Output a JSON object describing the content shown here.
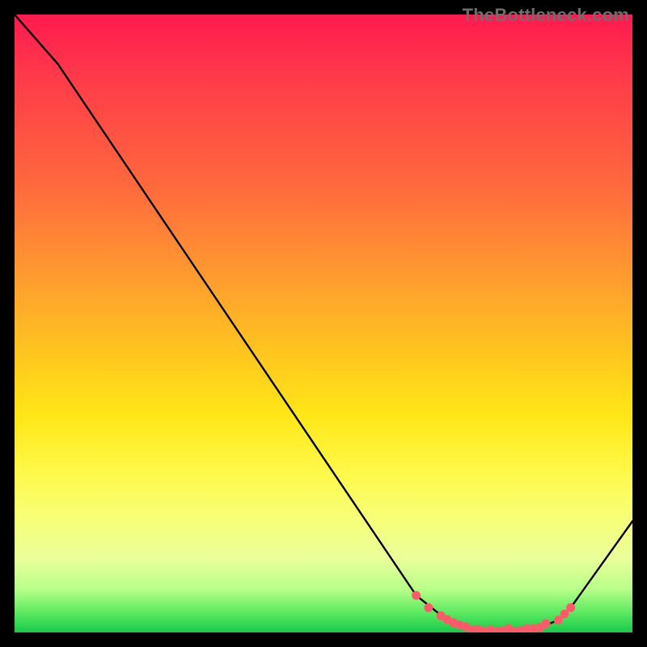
{
  "attribution": "TheBottleneck.com",
  "chart_data": {
    "type": "line",
    "title": "",
    "xlabel": "",
    "ylabel": "",
    "xlim": [
      0,
      100
    ],
    "ylim": [
      0,
      100
    ],
    "series": [
      {
        "name": "bottleneck-curve",
        "x": [
          0,
          7,
          65,
          70,
          74,
          78,
          82,
          85,
          88,
          90,
          100
        ],
        "y": [
          100,
          92,
          6,
          2,
          0.4,
          0.2,
          0.3,
          0.8,
          2,
          4,
          18
        ]
      }
    ],
    "markers": {
      "name": "optimal-range-dots",
      "color": "#ff5a6a",
      "x": [
        65,
        67,
        69,
        70,
        71,
        72,
        73,
        74,
        75,
        76,
        77,
        78,
        79,
        80,
        81,
        82,
        83,
        84,
        85,
        86,
        88,
        89,
        90
      ],
      "y": [
        6,
        4,
        2.7,
        2.1,
        1.6,
        1.2,
        0.9,
        0.4,
        0.5,
        0.2,
        0.4,
        0.2,
        0.3,
        0.6,
        0.2,
        0.3,
        0.6,
        0.6,
        0.8,
        1.4,
        2,
        3,
        4
      ]
    },
    "gradient_stops": [
      {
        "pct": 0,
        "color": "#ff1a50"
      },
      {
        "pct": 10,
        "color": "#ff3a4a"
      },
      {
        "pct": 28,
        "color": "#ff6a3d"
      },
      {
        "pct": 42,
        "color": "#ff9a30"
      },
      {
        "pct": 55,
        "color": "#ffc61f"
      },
      {
        "pct": 65,
        "color": "#ffe718"
      },
      {
        "pct": 74,
        "color": "#fff94a"
      },
      {
        "pct": 82,
        "color": "#f6ff7a"
      },
      {
        "pct": 88,
        "color": "#eaff9a"
      },
      {
        "pct": 93,
        "color": "#b8ff88"
      },
      {
        "pct": 97,
        "color": "#57e85f"
      },
      {
        "pct": 100,
        "color": "#18c94a"
      }
    ]
  }
}
